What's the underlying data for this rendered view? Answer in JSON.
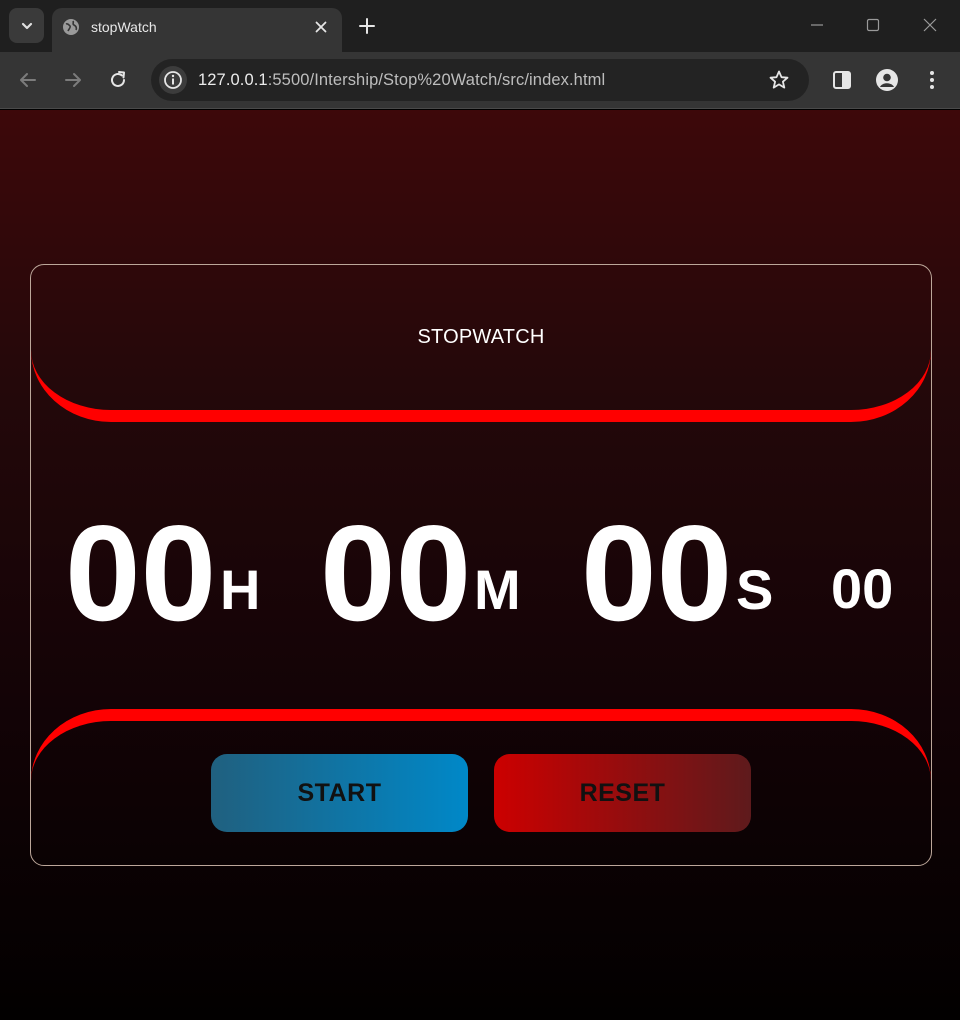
{
  "browser": {
    "tab_title": "stopWatch",
    "url_host": "127.0.0.1",
    "url_rest": ":5500/Intership/Stop%20Watch/src/index.html"
  },
  "app": {
    "title": "STOPWATCH",
    "hours": "00",
    "hours_unit": "H",
    "minutes": "00",
    "minutes_unit": "M",
    "seconds": "00",
    "seconds_unit": "S",
    "milliseconds": "00",
    "start_label": "START",
    "reset_label": "RESET"
  },
  "colors": {
    "accent_red": "#ff0000",
    "start_gradient": [
      "#20607f",
      "#0088c8"
    ],
    "reset_gradient": [
      "#cc0000",
      "#5e1a1c"
    ]
  }
}
